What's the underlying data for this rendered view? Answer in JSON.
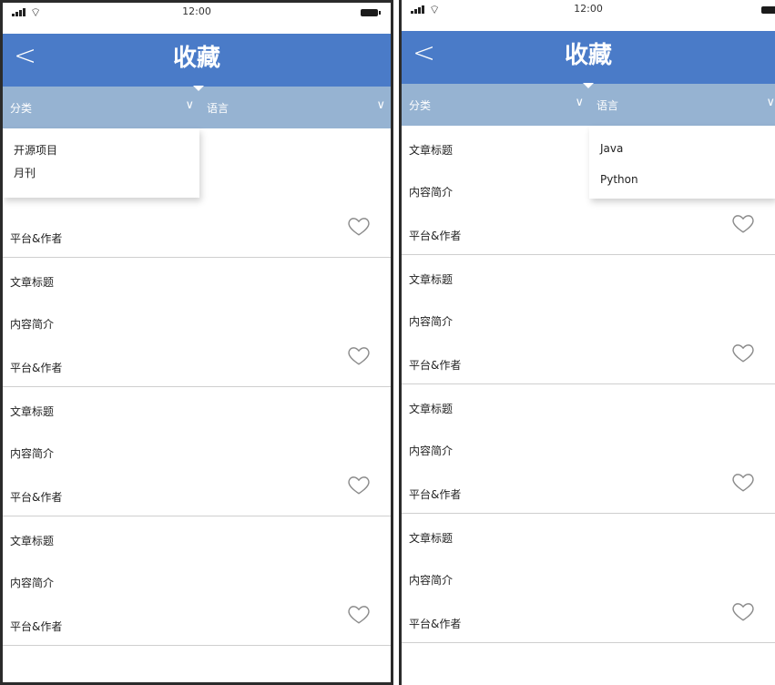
{
  "status_bar": {
    "time": "12:00"
  },
  "nav": {
    "back_symbol": "<",
    "title": "收藏"
  },
  "filters": {
    "category": "分类",
    "language": "语言",
    "chevron": "∨"
  },
  "left_dropdown": [
    "开源项目",
    "月刊"
  ],
  "right_dropdown": [
    "Java",
    "Python"
  ],
  "item": {
    "title": "文章标题",
    "summary": "内容简介",
    "author": "平台&作者"
  },
  "colors": {
    "nav": "#4a7bc8",
    "filter_bar": "#96b3d2"
  },
  "icons": {
    "back": "chevron-left-icon",
    "favorite": "heart-outline-icon",
    "signal": "signal-icon",
    "wifi": "wifi-icon",
    "battery": "battery-icon"
  }
}
